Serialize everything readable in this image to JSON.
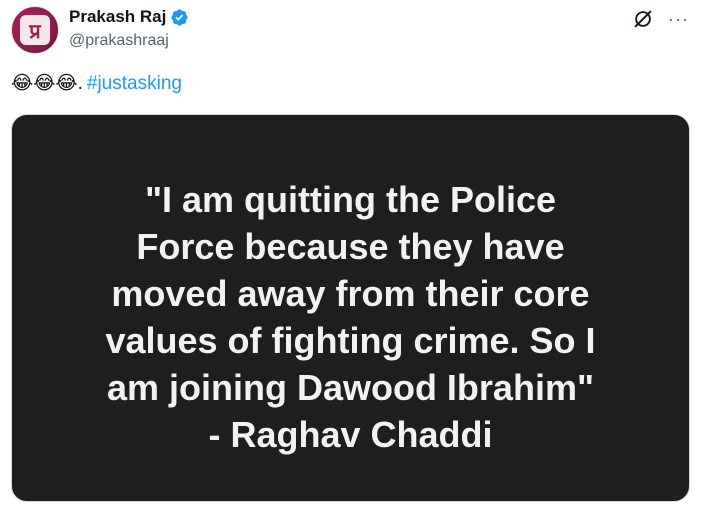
{
  "author": {
    "display_name": "Prakash Raj",
    "handle": "@prakashraaj",
    "avatar_glyph": "प्र",
    "verified_icon": "verified-badge-icon",
    "verified_color": "#1d9bf0"
  },
  "actions": {
    "grok_icon": "grok-icon",
    "more_icon": "more-options-icon",
    "more_label": "···"
  },
  "tweet": {
    "emojis": "😂😂😂",
    "separator": ".",
    "hashtag": "#justasking",
    "hashtag_color": "#1d9bf0"
  },
  "media": {
    "background": "#1e1e1e",
    "text_color": "#f2f2f2",
    "lines": [
      "\"I am quitting the Police",
      "Force because they have",
      "moved away from their core",
      "values of fighting crime. So I",
      "am joining Dawood Ibrahim\"",
      "- Raghav Chaddi"
    ]
  }
}
